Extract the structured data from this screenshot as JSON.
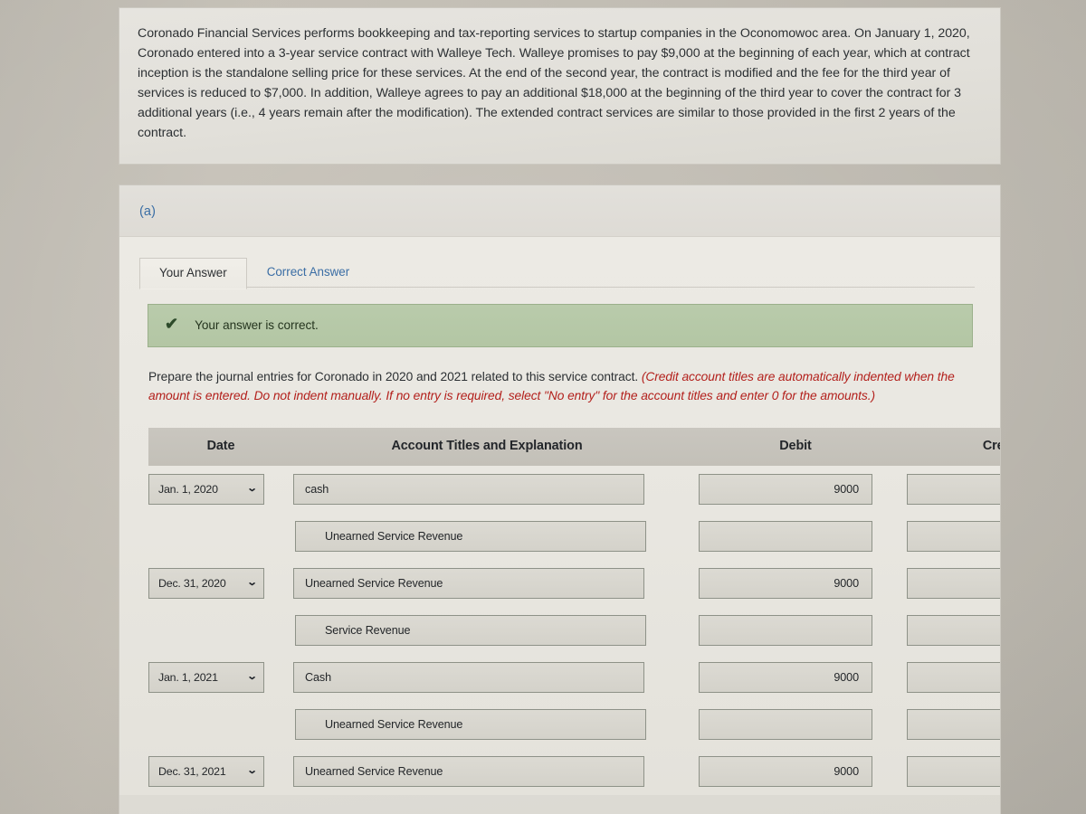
{
  "problem": {
    "text": "Coronado Financial Services performs bookkeeping and tax-reporting services to startup companies in the Oconomowoc area. On January 1, 2020, Coronado entered into a 3-year service contract with Walleye Tech. Walleye promises to pay $9,000 at the beginning of each year, which at contract inception is the standalone selling price for these services. At the end of the second year, the contract is modified and the fee for the third year of services is reduced to $7,000. In addition, Walleye agrees to pay an additional $18,000 at the beginning of the third year to cover the contract for 3 additional years (i.e., 4 years remain after the modification). The extended contract services are similar to those provided in the first 2 years of the contract."
  },
  "part": {
    "label": "(a)"
  },
  "tabs": [
    {
      "label": "Your Answer",
      "active": true
    },
    {
      "label": "Correct Answer",
      "active": false
    }
  ],
  "banner": {
    "icon": "checkmark-icon",
    "glyph": "✔",
    "text": "Your answer is correct.",
    "background_color": "#b5c8a6",
    "border_color": "#9bb08b",
    "text_color": "#25351f"
  },
  "instructions": {
    "lead": "Prepare the journal entries for Coronado in 2020 and 2021 related to this service contract. ",
    "hint": "(Credit account titles are automatically indented when the amount is entered. Do not indent manually. If no entry is required, select \"No entry\" for the account titles and enter 0 for the amounts.)",
    "hint_color": "#b3201c"
  },
  "table": {
    "headers": {
      "date": "Date",
      "account": "Account Titles and Explanation",
      "debit": "Debit",
      "credit": "Credi"
    },
    "rows": [
      {
        "date": "Jan. 1, 2020",
        "has_date": true,
        "account": "cash",
        "indent": false,
        "debit": "9000",
        "credit": ""
      },
      {
        "date": "",
        "has_date": false,
        "account": "Unearned Service Revenue",
        "indent": true,
        "debit": "",
        "credit": ""
      },
      {
        "date": "Dec. 31, 2020",
        "has_date": true,
        "account": "Unearned Service Revenue",
        "indent": false,
        "debit": "9000",
        "credit": ""
      },
      {
        "date": "",
        "has_date": false,
        "account": "Service Revenue",
        "indent": true,
        "debit": "",
        "credit": ""
      },
      {
        "date": "Jan. 1, 2021",
        "has_date": true,
        "account": "Cash",
        "indent": false,
        "debit": "9000",
        "credit": ""
      },
      {
        "date": "",
        "has_date": false,
        "account": "Unearned Service Revenue",
        "indent": true,
        "debit": "",
        "credit": ""
      },
      {
        "date": "Dec. 31, 2021",
        "has_date": true,
        "account": "Unearned Service Revenue",
        "indent": false,
        "debit": "9000",
        "credit": ""
      }
    ]
  },
  "colors": {
    "page_background": "#bdb8ae",
    "card_background": "#e4e2dc",
    "link_blue": "#3b6ea5",
    "control_border": "#8e9288",
    "control_fill": "#d8d6cf",
    "header_fill": "#c6c3bb"
  },
  "icons": {
    "chevron_down": "⌄",
    "check": "✔"
  }
}
